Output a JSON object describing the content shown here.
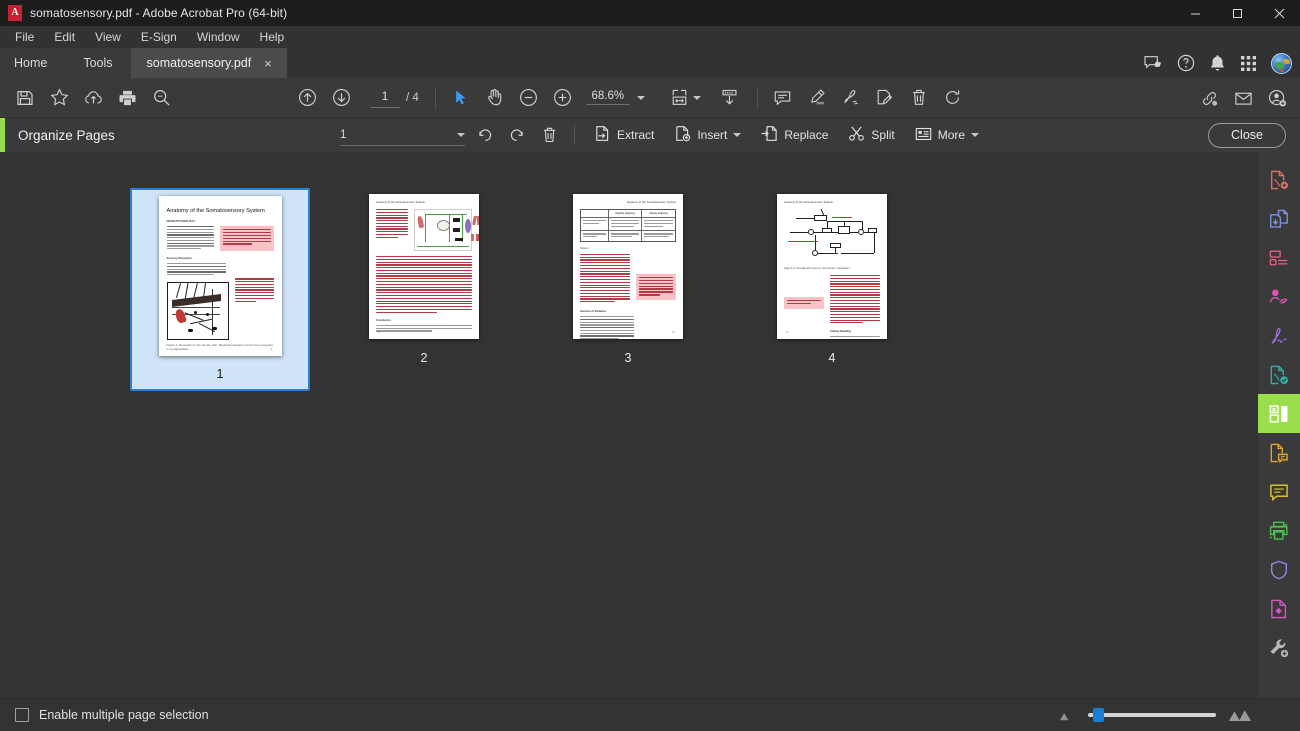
{
  "window": {
    "title": "somatosensory.pdf - Adobe Acrobat Pro (64-bit)",
    "app_icon": "acrobat-icon",
    "minimize": "Minimize",
    "maximize": "Maximize",
    "close": "Close"
  },
  "menubar": {
    "items": [
      {
        "label": "File"
      },
      {
        "label": "Edit"
      },
      {
        "label": "View"
      },
      {
        "label": "E-Sign"
      },
      {
        "label": "Window"
      },
      {
        "label": "Help"
      }
    ]
  },
  "tabstrip": {
    "home": "Home",
    "tools": "Tools",
    "document_tab": "somatosensory.pdf",
    "tab_close": "×",
    "icons": [
      {
        "name": "feedback-icon"
      },
      {
        "name": "help-icon"
      },
      {
        "name": "bell-icon"
      },
      {
        "name": "apps-grid-icon"
      },
      {
        "name": "user-avatar"
      }
    ]
  },
  "toolbar": {
    "save_label": "Save",
    "star_label": "Add to favorites",
    "cloud_label": "Save to cloud",
    "print_label": "Print",
    "search_label": "Find",
    "prev_page_label": "Previous page",
    "next_page_label": "Next page",
    "page_current": "1",
    "page_total": "/ 4",
    "select_label": "Select tool",
    "hand_label": "Hand tool",
    "zoom_out_label": "Zoom out",
    "zoom_in_label": "Zoom in",
    "zoom_value": "68.6%",
    "fit_label": "Fit page width",
    "scroll_label": "Scroll mode",
    "comment_label": "Add comment",
    "highlight_label": "Highlight text",
    "draw_label": "Draw",
    "fill_sign_label": "Fill and sign",
    "delete_label": "Delete pages",
    "rotate_label": "Rotate",
    "share_link_label": "Share link",
    "email_label": "Send by email",
    "add_user_label": "Add user"
  },
  "organize_bar": {
    "title": "Organize Pages",
    "page_select_value": "1",
    "undo_label": "Undo",
    "redo_label": "Redo",
    "delete_label": "Delete",
    "buttons": [
      {
        "label": "Extract",
        "icon": "extract-icon",
        "caret": false
      },
      {
        "label": "Insert",
        "icon": "insert-icon",
        "caret": true
      },
      {
        "label": "Replace",
        "icon": "replace-icon",
        "caret": false
      },
      {
        "label": "Split",
        "icon": "split-scissors-icon",
        "caret": false
      },
      {
        "label": "More",
        "icon": "more-list-icon",
        "caret": true
      }
    ],
    "close_label": "Close"
  },
  "pages": [
    {
      "number": "1",
      "selected": true,
      "title": "Anatomy of the Somatosensory System",
      "subhead": "FROM PSYCHOLOGY",
      "section": "Sensory Receptors",
      "caption": "Figure 1: Receptors in the human skin: Mechanoreceptors can be free receptors or encapsulated.",
      "folio": "1"
    },
    {
      "number": "2",
      "selected": false,
      "header": "Anatomy of the Somatosensory System",
      "section": "Conclusion",
      "folio": "2"
    },
    {
      "number": "3",
      "selected": false,
      "header": "Anatomy of the Somatosensory System",
      "table_headers": [
        "",
        "Rapidly adapting",
        "Slowly adapting"
      ],
      "section": "Sources of Variation",
      "folio": "3"
    },
    {
      "number": "4",
      "selected": false,
      "header": "Anatomy of the Somatosensory System",
      "caption": "Figure 2: Feedback loops in perception regulation.",
      "section": "Further Reading",
      "folio": "4"
    }
  ],
  "rail": {
    "items": [
      {
        "name": "create-pdf-icon",
        "color": "#e2705e",
        "active": false
      },
      {
        "name": "combine-files-icon",
        "color": "#7d8fe0",
        "active": false
      },
      {
        "name": "edit-pdf-icon",
        "color": "#e0607f",
        "active": false
      },
      {
        "name": "export-pdf-icon",
        "color": "#d657ad",
        "active": false
      },
      {
        "name": "sign-icon",
        "color": "#9b6fe0",
        "active": false
      },
      {
        "name": "protect-pdf-icon",
        "color": "#2fb3a8",
        "active": false
      },
      {
        "name": "organize-pages-icon",
        "color": "#ffffff",
        "active": true
      },
      {
        "name": "request-signatures-icon",
        "color": "#e0a82e",
        "active": false
      },
      {
        "name": "comment-icon",
        "color": "#d8c12e",
        "active": false
      },
      {
        "name": "print-production-icon",
        "color": "#4ec24e",
        "active": false
      },
      {
        "name": "protect-shield-icon",
        "color": "#9b87e0",
        "active": false
      },
      {
        "name": "redact-icon",
        "color": "#d657c9",
        "active": false
      },
      {
        "name": "more-tools-icon",
        "color": "#b8b8b8",
        "active": false
      }
    ]
  },
  "statusbar": {
    "checkbox_label": "Enable multiple page selection",
    "checkbox_checked": false,
    "zoom_small_icon": "small-thumbnails-icon",
    "zoom_large_icon": "large-thumbnails-icon",
    "slider_value": 6
  }
}
